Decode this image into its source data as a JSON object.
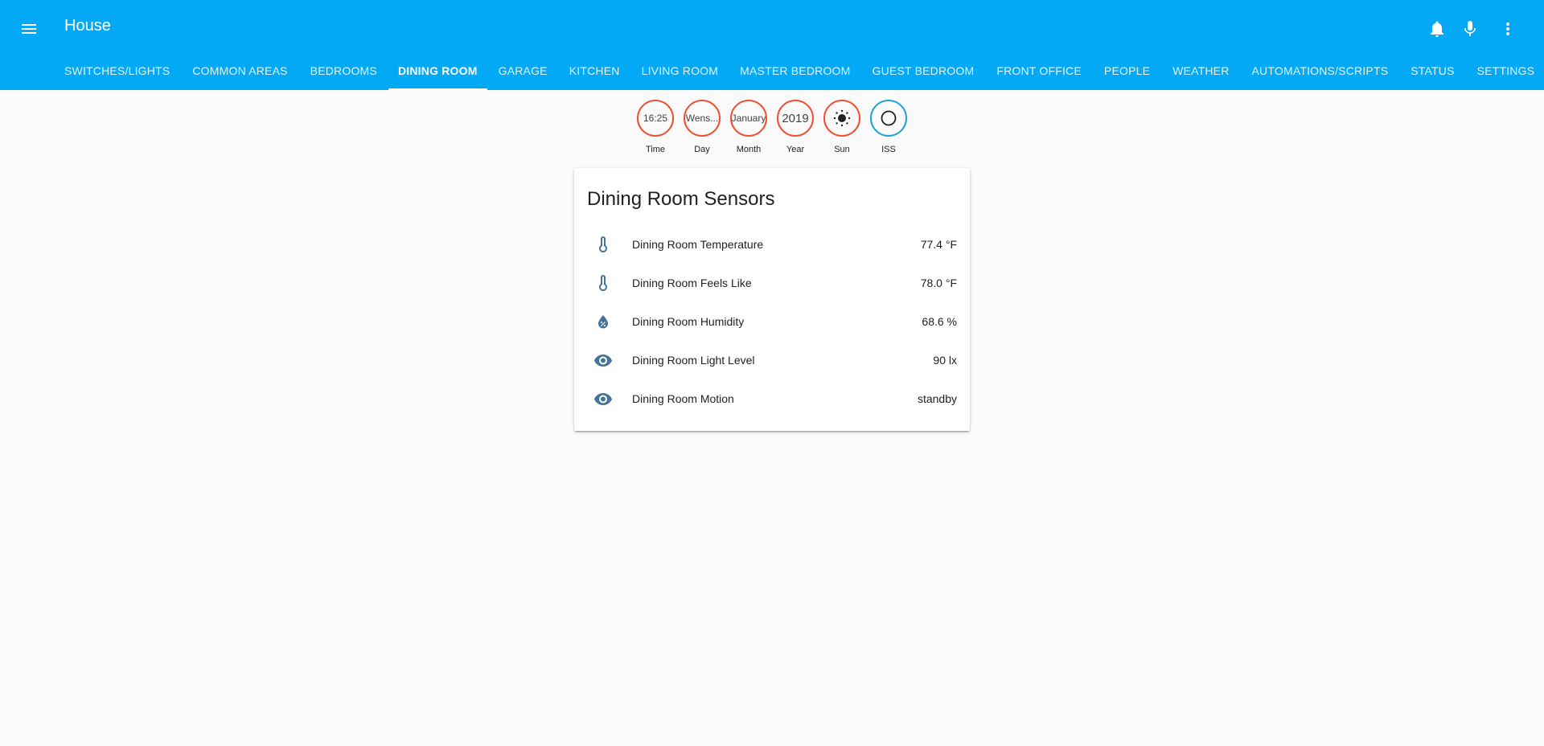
{
  "header": {
    "title": "House",
    "menu_icon": "menu-icon",
    "actions": [
      "bell-icon",
      "microphone-icon",
      "more-vert-icon"
    ]
  },
  "tabs": [
    {
      "label": "SWITCHES/LIGHTS",
      "active": false
    },
    {
      "label": "COMMON AREAS",
      "active": false
    },
    {
      "label": "BEDROOMS",
      "active": false
    },
    {
      "label": "DINING ROOM",
      "active": true
    },
    {
      "label": "GARAGE",
      "active": false
    },
    {
      "label": "KITCHEN",
      "active": false
    },
    {
      "label": "LIVING ROOM",
      "active": false
    },
    {
      "label": "MASTER BEDROOM",
      "active": false
    },
    {
      "label": "GUEST BEDROOM",
      "active": false
    },
    {
      "label": "FRONT OFFICE",
      "active": false
    },
    {
      "label": "PEOPLE",
      "active": false
    },
    {
      "label": "WEATHER",
      "active": false
    },
    {
      "label": "AUTOMATIONS/SCRIPTS",
      "active": false
    },
    {
      "label": "STATUS",
      "active": false
    },
    {
      "label": "SETTINGS",
      "active": false
    }
  ],
  "badges": [
    {
      "value": "16:25",
      "label": "Time",
      "color": "#ef4f30"
    },
    {
      "value": "Wens...",
      "label": "Day",
      "color": "#ef4f30"
    },
    {
      "value": "January",
      "label": "Month",
      "color": "#ef4f30"
    },
    {
      "value": "2019",
      "label": "Year",
      "color": "#ef4f30"
    },
    {
      "value": "",
      "icon": "sun-icon",
      "label": "Sun",
      "color": "#ef4f30"
    },
    {
      "value": "",
      "icon": "circle-outline-icon",
      "label": "ISS",
      "color": "#1fa1d4"
    }
  ],
  "card": {
    "title": "Dining Room Sensors",
    "icon_color": "#44739e",
    "rows": [
      {
        "name": "Dining Room Temperature",
        "value": "77.4 °F",
        "icon": "thermometer-icon"
      },
      {
        "name": "Dining Room Feels Like",
        "value": "78.0 °F",
        "icon": "thermometer-icon"
      },
      {
        "name": "Dining Room Humidity",
        "value": "68.6 %",
        "icon": "water-percent-icon"
      },
      {
        "name": "Dining Room Light Level",
        "value": "90 lx",
        "icon": "eye-icon"
      },
      {
        "name": "Dining Room Motion",
        "value": "standby",
        "icon": "eye-icon"
      }
    ]
  }
}
